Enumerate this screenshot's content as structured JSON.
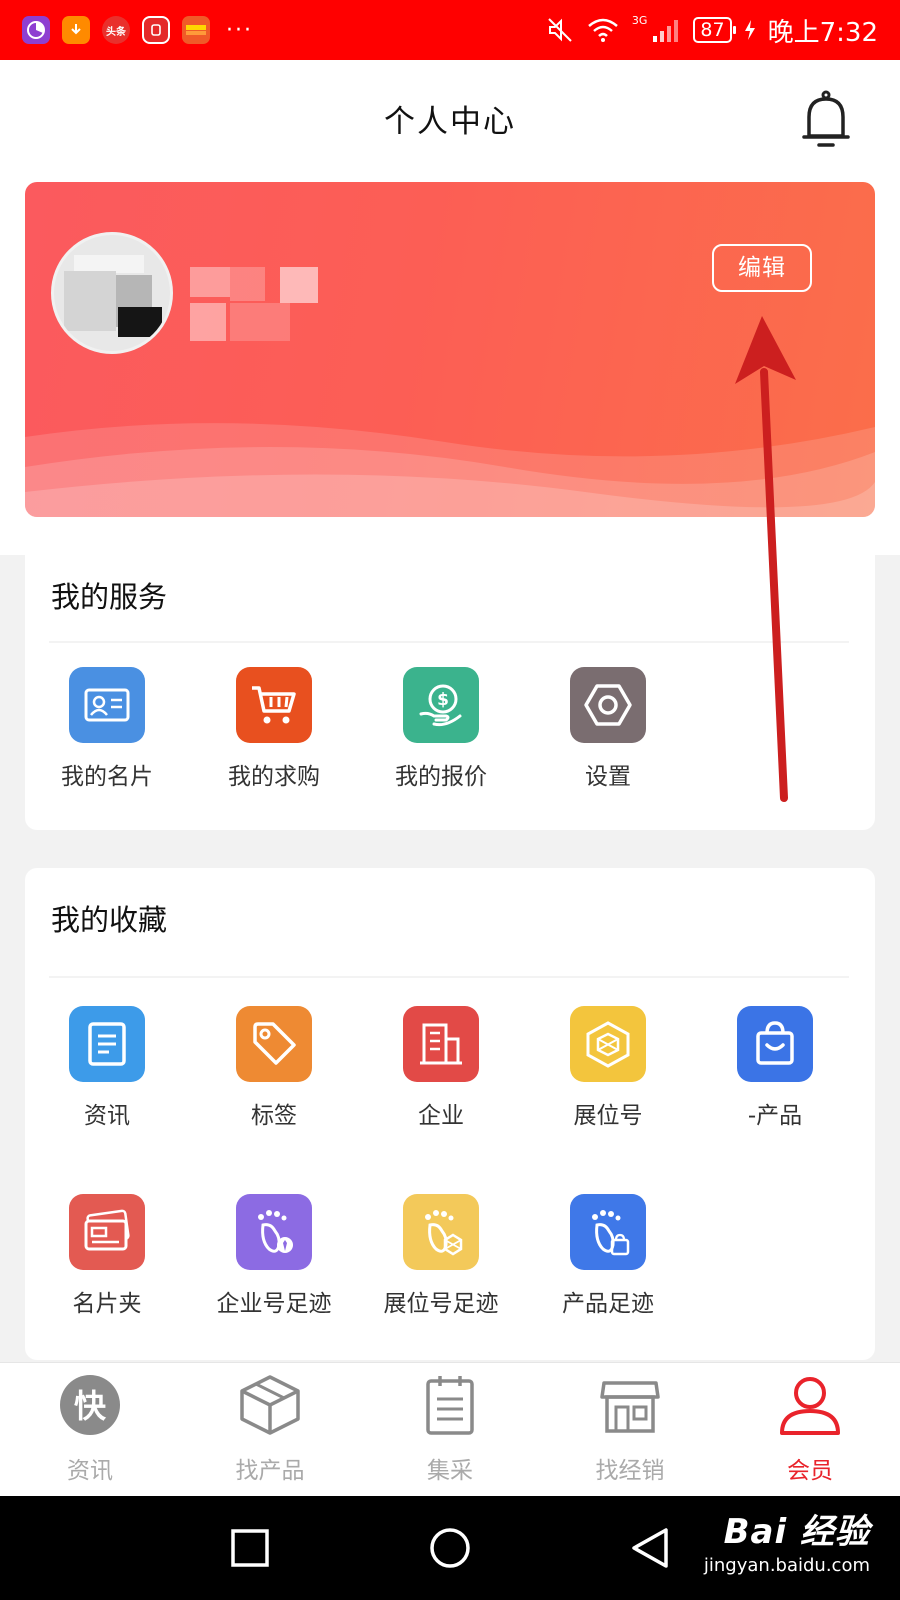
{
  "status_bar": {
    "background": "#ff0000",
    "notification_icons": [
      "pie-chart-app",
      "download-app",
      "toutiao-app",
      "block-app",
      "huawei-app"
    ],
    "toutiao_label": "头条",
    "more": "···",
    "network": "3G",
    "battery": "87",
    "time": "晚上7:32"
  },
  "header": {
    "title": "个人中心"
  },
  "profile": {
    "edit_label": "编辑"
  },
  "services": {
    "title": "我的服务",
    "items": [
      {
        "label": "我的名片",
        "icon": "business-card-icon",
        "color": "#4a90e2"
      },
      {
        "label": "我的求购",
        "icon": "shopping-cart-icon",
        "color": "#e8501f"
      },
      {
        "label": "我的报价",
        "icon": "money-hand-icon",
        "color": "#3bb38d"
      },
      {
        "label": "设置",
        "icon": "settings-nut-icon",
        "color": "#7a6d70"
      }
    ]
  },
  "favorites": {
    "title": "我的收藏",
    "items": [
      {
        "label": "资讯",
        "icon": "news-doc-icon",
        "color": "#3d9be9"
      },
      {
        "label": "标签",
        "icon": "tag-icon",
        "color": "#ee8a33"
      },
      {
        "label": "企业",
        "icon": "building-icon",
        "color": "#e24a47"
      },
      {
        "label": "展位号",
        "icon": "booth-cube-icon",
        "color": "#f3c53d"
      },
      {
        "label": "-产品",
        "icon": "shopping-bag-icon",
        "color": "#3b74e6"
      },
      {
        "label": "名片夹",
        "icon": "card-holder-icon",
        "color": "#e35a52"
      },
      {
        "label": "企业号足迹",
        "icon": "footprint-tie-icon",
        "color": "#8c6be3"
      },
      {
        "label": "展位号足迹",
        "icon": "footprint-cube-icon",
        "color": "#f3c95a"
      },
      {
        "label": "产品足迹",
        "icon": "footprint-bag-icon",
        "color": "#3f78e8"
      }
    ]
  },
  "tabbar": {
    "items": [
      {
        "label": "资讯",
        "icon": "kuai-news-icon",
        "badge": "快",
        "active": false
      },
      {
        "label": "找产品",
        "icon": "cube-box-icon",
        "active": false
      },
      {
        "label": "集采",
        "icon": "clipboard-list-icon",
        "active": false
      },
      {
        "label": "找经销",
        "icon": "storefront-icon",
        "active": false
      },
      {
        "label": "会员",
        "icon": "person-icon",
        "active": true
      }
    ],
    "active_color": "#e9232b",
    "inactive_color": "#aaaaaa"
  },
  "watermark": {
    "logo": "Bai 经验",
    "url": "jingyan.baidu.com"
  }
}
